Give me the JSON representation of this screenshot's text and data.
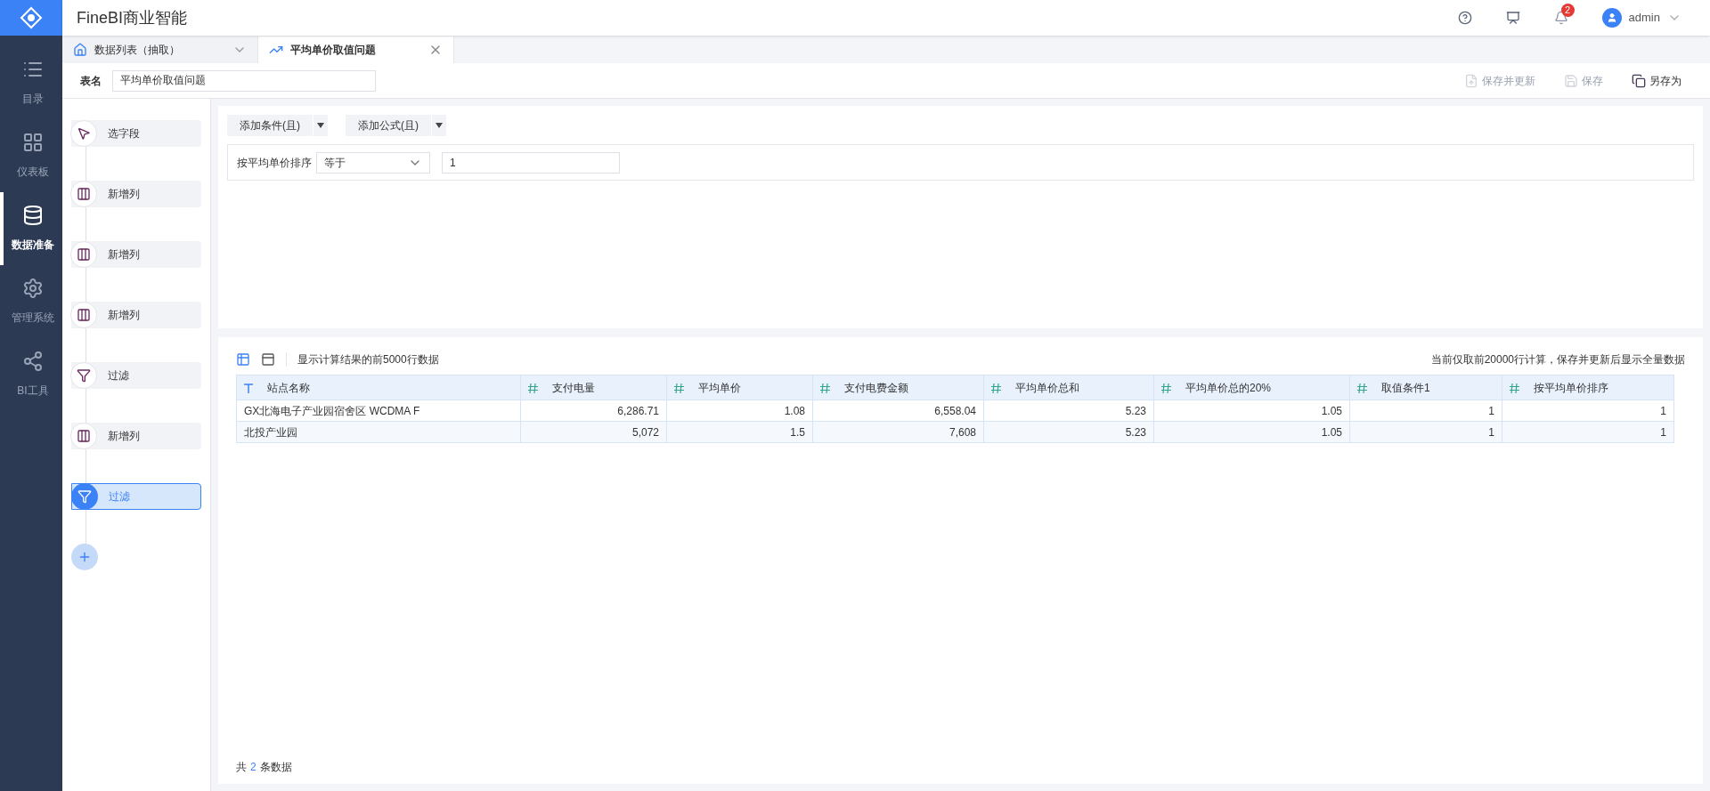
{
  "app": {
    "title": "FineBI商业智能"
  },
  "header": {
    "notification_count": "2",
    "user": "admin"
  },
  "nav": [
    {
      "label": "目录",
      "kind": "list",
      "selected": false
    },
    {
      "label": "仪表板",
      "kind": "dashboard",
      "selected": false
    },
    {
      "label": "数据准备",
      "kind": "data",
      "selected": true
    },
    {
      "label": "管理系统",
      "kind": "settings",
      "selected": false
    },
    {
      "label": "BI工具",
      "kind": "tools",
      "selected": false
    }
  ],
  "tabs": [
    {
      "label": "数据列表（抽取）",
      "kind": "home",
      "selected": false
    },
    {
      "label": "平均单价取值问题",
      "kind": "chart",
      "selected": true
    }
  ],
  "table_name": {
    "label": "表名",
    "value": "平均单价取值问题"
  },
  "toolbar": [
    {
      "label": "保存并更新",
      "kind": "save-update",
      "disabled": true
    },
    {
      "label": "保存",
      "kind": "save",
      "disabled": true
    },
    {
      "label": "另存为",
      "kind": "save-as",
      "disabled": false
    }
  ],
  "steps": [
    {
      "label": "选字段",
      "kind": "select",
      "selected": false
    },
    {
      "label": "新增列",
      "kind": "column",
      "selected": false
    },
    {
      "label": "新增列",
      "kind": "column",
      "selected": false
    },
    {
      "label": "新增列",
      "kind": "column",
      "selected": false
    },
    {
      "label": "过滤",
      "kind": "filter",
      "selected": false
    },
    {
      "label": "新增列",
      "kind": "column",
      "selected": false
    },
    {
      "label": "过滤",
      "kind": "filter",
      "selected": true
    }
  ],
  "filter": {
    "buttons": [
      "添加条件(且)",
      "添加公式(且)"
    ],
    "condition": {
      "field": "按平均单价排序",
      "operator": "等于",
      "value": "1"
    }
  },
  "preview": {
    "note": "显示计算结果的前5000行数据",
    "limit_note": "当前仅取前20000行计算，保存并更新后显示全量数据",
    "columns": [
      {
        "label": "站点名称",
        "kind": "text"
      },
      {
        "label": "支付电量",
        "kind": "number"
      },
      {
        "label": "平均单价",
        "kind": "number"
      },
      {
        "label": "支付电费金额",
        "kind": "number"
      },
      {
        "label": "平均单价总和",
        "kind": "number"
      },
      {
        "label": "平均单价总的20%",
        "kind": "number"
      },
      {
        "label": "取值条件1",
        "kind": "number"
      },
      {
        "label": "按平均单价排序",
        "kind": "number"
      }
    ],
    "rows": [
      [
        "GX北海电子产业园宿舍区 WCDMA F",
        "6,286.71",
        "1.08",
        "6,558.04",
        "5.23",
        "1.05",
        "1",
        "1"
      ],
      [
        "北投产业园",
        "5,072",
        "1.5",
        "7,608",
        "5.23",
        "1.05",
        "1",
        "1"
      ]
    ],
    "footer": {
      "prefix": "共",
      "count": "2",
      "suffix": "条数据"
    }
  }
}
